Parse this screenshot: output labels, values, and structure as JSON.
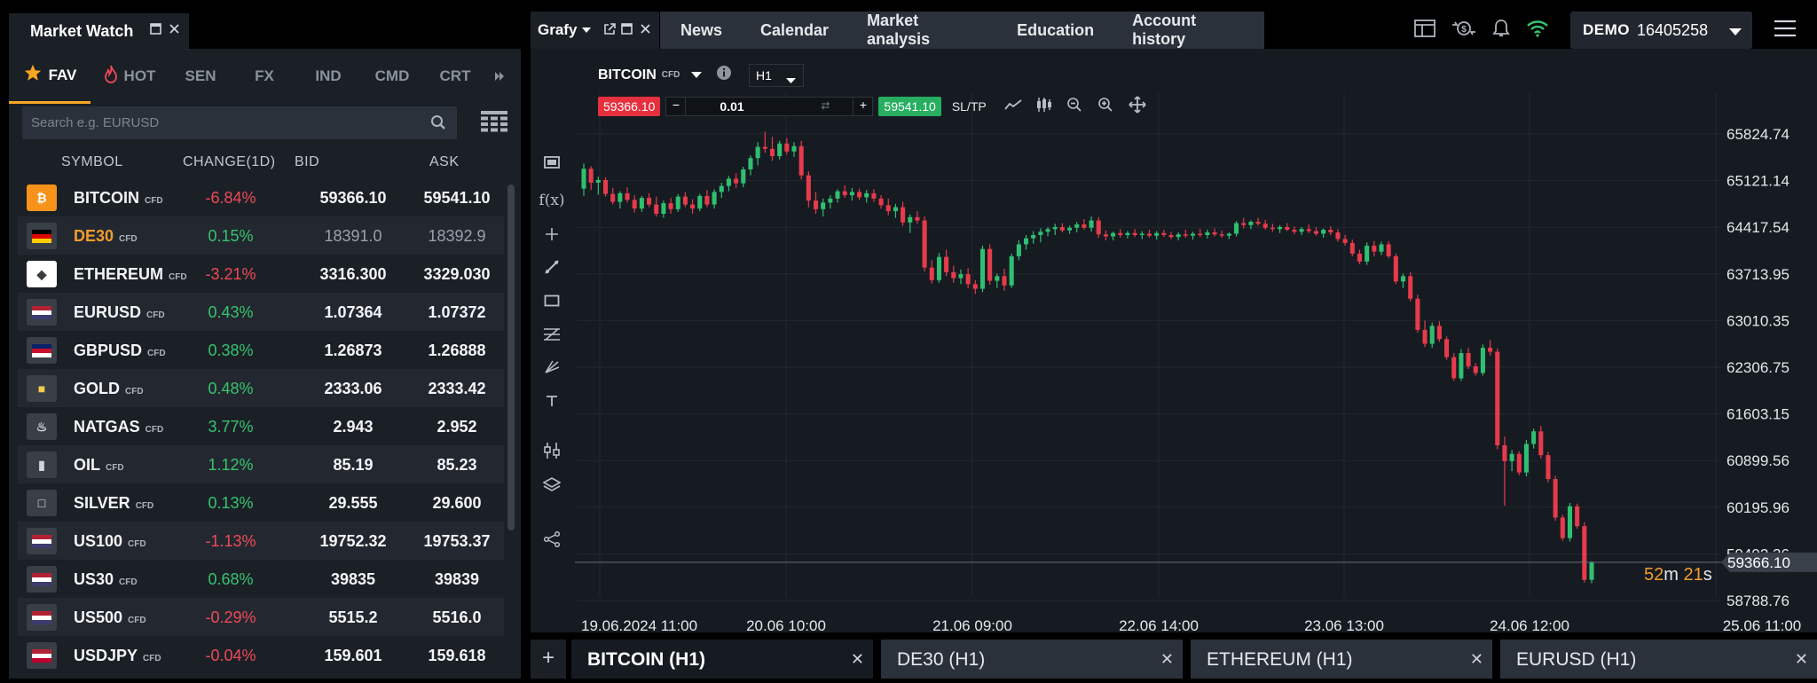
{
  "market_watch": {
    "title": "Market Watch",
    "categories": [
      {
        "label": "FAV",
        "icon": "star-icon",
        "active": true
      },
      {
        "label": "HOT",
        "icon": "fire-icon",
        "active": false
      },
      {
        "label": "SEN",
        "active": false
      },
      {
        "label": "FX",
        "active": false
      },
      {
        "label": "IND",
        "active": false
      },
      {
        "label": "CMD",
        "active": false
      },
      {
        "label": "CRT",
        "active": false
      }
    ],
    "search_placeholder": "Search e.g. EURUSD",
    "columns": {
      "symbol": "SYMBOL",
      "change": "CHANGE(1D)",
      "bid": "BID",
      "ask": "ASK"
    },
    "rows": [
      {
        "symbol": "BITCOIN",
        "tag": "CFD",
        "change": "-6.84%",
        "bid": "59366.10",
        "ask": "59541.10",
        "icon": "bitcoin-icon"
      },
      {
        "symbol": "DE30",
        "tag": "CFD",
        "change": "0.15%",
        "bid": "18391.0",
        "ask": "18392.9",
        "icon": "germany-flag-icon"
      },
      {
        "symbol": "ETHEREUM",
        "tag": "CFD",
        "change": "-3.21%",
        "bid": "3316.300",
        "ask": "3329.030",
        "icon": "ethereum-icon"
      },
      {
        "symbol": "EURUSD",
        "tag": "CFD",
        "change": "0.43%",
        "bid": "1.07364",
        "ask": "1.07372",
        "icon": "eu-us-flag-icon"
      },
      {
        "symbol": "GBPUSD",
        "tag": "CFD",
        "change": "0.38%",
        "bid": "1.26873",
        "ask": "1.26888",
        "icon": "uk-us-flag-icon"
      },
      {
        "symbol": "GOLD",
        "tag": "CFD",
        "change": "0.48%",
        "bid": "2333.06",
        "ask": "2333.42",
        "icon": "gold-icon"
      },
      {
        "symbol": "NATGAS",
        "tag": "CFD",
        "change": "3.77%",
        "bid": "2.943",
        "ask": "2.952",
        "icon": "flame-icon"
      },
      {
        "symbol": "OIL",
        "tag": "CFD",
        "change": "1.12%",
        "bid": "85.19",
        "ask": "85.23",
        "icon": "oil-icon"
      },
      {
        "symbol": "SILVER",
        "tag": "CFD",
        "change": "0.13%",
        "bid": "29.555",
        "ask": "29.600",
        "icon": "silver-icon"
      },
      {
        "symbol": "US100",
        "tag": "CFD",
        "change": "-1.13%",
        "bid": "19752.32",
        "ask": "19753.37",
        "icon": "us-flag-icon"
      },
      {
        "symbol": "US30",
        "tag": "CFD",
        "change": "0.68%",
        "bid": "39835",
        "ask": "39839",
        "icon": "us-flag-icon"
      },
      {
        "symbol": "US500",
        "tag": "CFD",
        "change": "-0.29%",
        "bid": "5515.2",
        "ask": "5516.0",
        "icon": "us-flag-icon"
      },
      {
        "symbol": "USDJPY",
        "tag": "CFD",
        "change": "-0.04%",
        "bid": "159.601",
        "ask": "159.618",
        "icon": "us-jp-flag-icon"
      }
    ]
  },
  "chart_window": {
    "tab_label": "Grafy",
    "nav": [
      "News",
      "Calendar",
      "Market analysis",
      "Education",
      "Account history"
    ],
    "account": {
      "mode": "DEMO",
      "number": "16405258"
    },
    "symbol": "BITCOIN",
    "symbol_tag": "CFD",
    "timeframe": "H1",
    "sell_price": "59366.10",
    "buy_price": "59541.10",
    "lot": "0.01",
    "sltp": "SL/TP",
    "countdown": {
      "m": "52",
      "m_unit": "m",
      "s": "21",
      "s_unit": "s"
    },
    "bottom_tabs": [
      {
        "label": "BITCOIN (H1)",
        "active": true
      },
      {
        "label": "DE30 (H1)",
        "active": false
      },
      {
        "label": "ETHEREUM (H1)",
        "active": false
      },
      {
        "label": "EURUSD (H1)",
        "active": false
      }
    ]
  },
  "chart_data": {
    "type": "candlestick",
    "y_ticks": [
      "65824.74",
      "65121.14",
      "64417.54",
      "63713.95",
      "63010.35",
      "62306.75",
      "61603.15",
      "60899.56",
      "60195.96",
      "59492.36",
      "58788.76"
    ],
    "ylim": [
      58788.76,
      65824.74
    ],
    "x_ticks": [
      "19.06.2024 11:00",
      "20.06 10:00",
      "21.06 09:00",
      "22.06 14:00",
      "23.06 13:00",
      "24.06 12:00",
      "25.06 11:00"
    ],
    "current_price": "59366.10",
    "current_price_value": 59366.1,
    "up_color": "#2fbf71",
    "down_color": "#e63b4c",
    "ohlc": [
      [
        65000,
        65380,
        64890,
        65300
      ],
      [
        65300,
        65340,
        64980,
        65090
      ],
      [
        65090,
        65180,
        64910,
        65130
      ],
      [
        65130,
        65170,
        64880,
        64920
      ],
      [
        64920,
        65010,
        64760,
        64800
      ],
      [
        64800,
        64960,
        64700,
        64930
      ],
      [
        64930,
        65020,
        64790,
        64830
      ],
      [
        64830,
        64900,
        64640,
        64700
      ],
      [
        64700,
        64890,
        64650,
        64860
      ],
      [
        64860,
        64930,
        64720,
        64760
      ],
      [
        64760,
        64880,
        64580,
        64620
      ],
      [
        64620,
        64820,
        64560,
        64780
      ],
      [
        64780,
        64860,
        64620,
        64690
      ],
      [
        64690,
        64920,
        64650,
        64880
      ],
      [
        64880,
        64950,
        64720,
        64760
      ],
      [
        64760,
        64840,
        64620,
        64700
      ],
      [
        64700,
        64920,
        64660,
        64890
      ],
      [
        64890,
        64980,
        64720,
        64760
      ],
      [
        64760,
        64990,
        64700,
        64950
      ],
      [
        64950,
        65090,
        64860,
        65040
      ],
      [
        65040,
        65190,
        64960,
        65150
      ],
      [
        65150,
        65230,
        65010,
        65080
      ],
      [
        65080,
        65330,
        65020,
        65290
      ],
      [
        65290,
        65500,
        65200,
        65460
      ],
      [
        65460,
        65700,
        65350,
        65630
      ],
      [
        65630,
        65860,
        65540,
        65600
      ],
      [
        65600,
        65780,
        65420,
        65490
      ],
      [
        65490,
        65720,
        65440,
        65680
      ],
      [
        65680,
        65760,
        65520,
        65560
      ],
      [
        65560,
        65700,
        65480,
        65640
      ],
      [
        65640,
        65720,
        65140,
        65200
      ],
      [
        65200,
        65260,
        64720,
        64820
      ],
      [
        64820,
        64950,
        64620,
        64690
      ],
      [
        64690,
        64850,
        64580,
        64790
      ],
      [
        64790,
        64900,
        64700,
        64850
      ],
      [
        64850,
        64990,
        64790,
        64960
      ],
      [
        64960,
        65050,
        64860,
        64900
      ],
      [
        64900,
        65010,
        64820,
        64950
      ],
      [
        64950,
        65000,
        64830,
        64870
      ],
      [
        64870,
        64980,
        64790,
        64930
      ],
      [
        64930,
        64990,
        64800,
        64850
      ],
      [
        64850,
        64900,
        64700,
        64750
      ],
      [
        64750,
        64850,
        64600,
        64660
      ],
      [
        64660,
        64770,
        64560,
        64720
      ],
      [
        64720,
        64800,
        64440,
        64490
      ],
      [
        64490,
        64610,
        64330,
        64570
      ],
      [
        64570,
        64660,
        64470,
        64520
      ],
      [
        64520,
        64580,
        63750,
        63810
      ],
      [
        63810,
        63920,
        63570,
        63620
      ],
      [
        63620,
        64030,
        63580,
        63970
      ],
      [
        63970,
        64080,
        63680,
        63740
      ],
      [
        63740,
        63840,
        63580,
        63650
      ],
      [
        63650,
        63780,
        63560,
        63710
      ],
      [
        63710,
        63800,
        63500,
        63560
      ],
      [
        63560,
        63620,
        63410,
        63490
      ],
      [
        63490,
        64140,
        63440,
        64090
      ],
      [
        64090,
        64160,
        63550,
        63610
      ],
      [
        63610,
        63720,
        63500,
        63680
      ],
      [
        63680,
        63790,
        63460,
        63540
      ],
      [
        63540,
        64020,
        63500,
        63980
      ],
      [
        63980,
        64220,
        63920,
        64160
      ],
      [
        64160,
        64300,
        64080,
        64250
      ],
      [
        64250,
        64360,
        64170,
        64300
      ],
      [
        64300,
        64400,
        64190,
        64350
      ],
      [
        64350,
        64420,
        64280,
        64390
      ],
      [
        64390,
        64470,
        64300,
        64420
      ],
      [
        64420,
        64480,
        64340,
        64370
      ],
      [
        64370,
        64440,
        64320,
        64410
      ],
      [
        64410,
        64500,
        64340,
        64460
      ],
      [
        64460,
        64540,
        64380,
        64410
      ],
      [
        64410,
        64580,
        64350,
        64520
      ],
      [
        64520,
        64570,
        64260,
        64310
      ],
      [
        64310,
        64370,
        64220,
        64280
      ],
      [
        64280,
        64350,
        64220,
        64330
      ],
      [
        64330,
        64390,
        64260,
        64300
      ],
      [
        64300,
        64360,
        64250,
        64330
      ],
      [
        64330,
        64390,
        64270,
        64300
      ],
      [
        64300,
        64360,
        64240,
        64320
      ],
      [
        64320,
        64380,
        64260,
        64290
      ],
      [
        64290,
        64360,
        64230,
        64330
      ],
      [
        64330,
        64380,
        64270,
        64300
      ],
      [
        64300,
        64350,
        64240,
        64270
      ],
      [
        64270,
        64340,
        64220,
        64310
      ],
      [
        64310,
        64380,
        64260,
        64290
      ],
      [
        64290,
        64350,
        64230,
        64320
      ],
      [
        64320,
        64390,
        64270,
        64300
      ],
      [
        64300,
        64380,
        64250,
        64340
      ],
      [
        64340,
        64400,
        64280,
        64310
      ],
      [
        64310,
        64370,
        64260,
        64290
      ],
      [
        64290,
        64340,
        64240,
        64320
      ],
      [
        64320,
        64510,
        64280,
        64480
      ],
      [
        64480,
        64560,
        64400,
        64450
      ],
      [
        64450,
        64520,
        64390,
        64500
      ],
      [
        64500,
        64560,
        64440,
        64470
      ],
      [
        64470,
        64530,
        64380,
        64410
      ],
      [
        64410,
        64470,
        64350,
        64390
      ],
      [
        64390,
        64450,
        64330,
        64420
      ],
      [
        64420,
        64480,
        64360,
        64380
      ],
      [
        64380,
        64430,
        64310,
        64350
      ],
      [
        64350,
        64420,
        64300,
        64390
      ],
      [
        64390,
        64460,
        64330,
        64360
      ],
      [
        64360,
        64420,
        64290,
        64320
      ],
      [
        64320,
        64400,
        64260,
        64380
      ],
      [
        64380,
        64430,
        64300,
        64340
      ],
      [
        64340,
        64390,
        64200,
        64240
      ],
      [
        64240,
        64300,
        64140,
        64180
      ],
      [
        64180,
        64230,
        63980,
        64020
      ],
      [
        64020,
        64080,
        63860,
        63900
      ],
      [
        63900,
        64190,
        63850,
        64140
      ],
      [
        64140,
        64210,
        63980,
        64050
      ],
      [
        64050,
        64200,
        64000,
        64160
      ],
      [
        64160,
        64210,
        63950,
        63980
      ],
      [
        63980,
        64020,
        63560,
        63600
      ],
      [
        63600,
        63720,
        63500,
        63680
      ],
      [
        63680,
        63740,
        63300,
        63340
      ],
      [
        63340,
        63400,
        62830,
        62870
      ],
      [
        62870,
        63010,
        62610,
        62660
      ],
      [
        62660,
        62980,
        62600,
        62930
      ],
      [
        62930,
        63000,
        62690,
        62730
      ],
      [
        62730,
        62770,
        62420,
        62460
      ],
      [
        62460,
        62520,
        62100,
        62140
      ],
      [
        62140,
        62580,
        62100,
        62520
      ],
      [
        62520,
        62600,
        62280,
        62320
      ],
      [
        62320,
        62370,
        62180,
        62220
      ],
      [
        62220,
        62650,
        62180,
        62600
      ],
      [
        62600,
        62720,
        62480,
        62540
      ],
      [
        62540,
        62590,
        61070,
        61130
      ],
      [
        61130,
        61260,
        60220,
        60890
      ],
      [
        60890,
        61060,
        60740,
        61000
      ],
      [
        61000,
        61040,
        60680,
        60720
      ],
      [
        60720,
        61210,
        60660,
        61150
      ],
      [
        61150,
        61380,
        61080,
        61340
      ],
      [
        61340,
        61420,
        60930,
        60980
      ],
      [
        60980,
        61030,
        60570,
        60620
      ],
      [
        60620,
        60670,
        59990,
        60040
      ],
      [
        60040,
        60080,
        59690,
        59730
      ],
      [
        59730,
        60260,
        59680,
        60210
      ],
      [
        60210,
        60250,
        59870,
        59910
      ],
      [
        59910,
        59970,
        59060,
        59100
      ],
      [
        59100,
        59380,
        59050,
        59366.1
      ]
    ]
  }
}
